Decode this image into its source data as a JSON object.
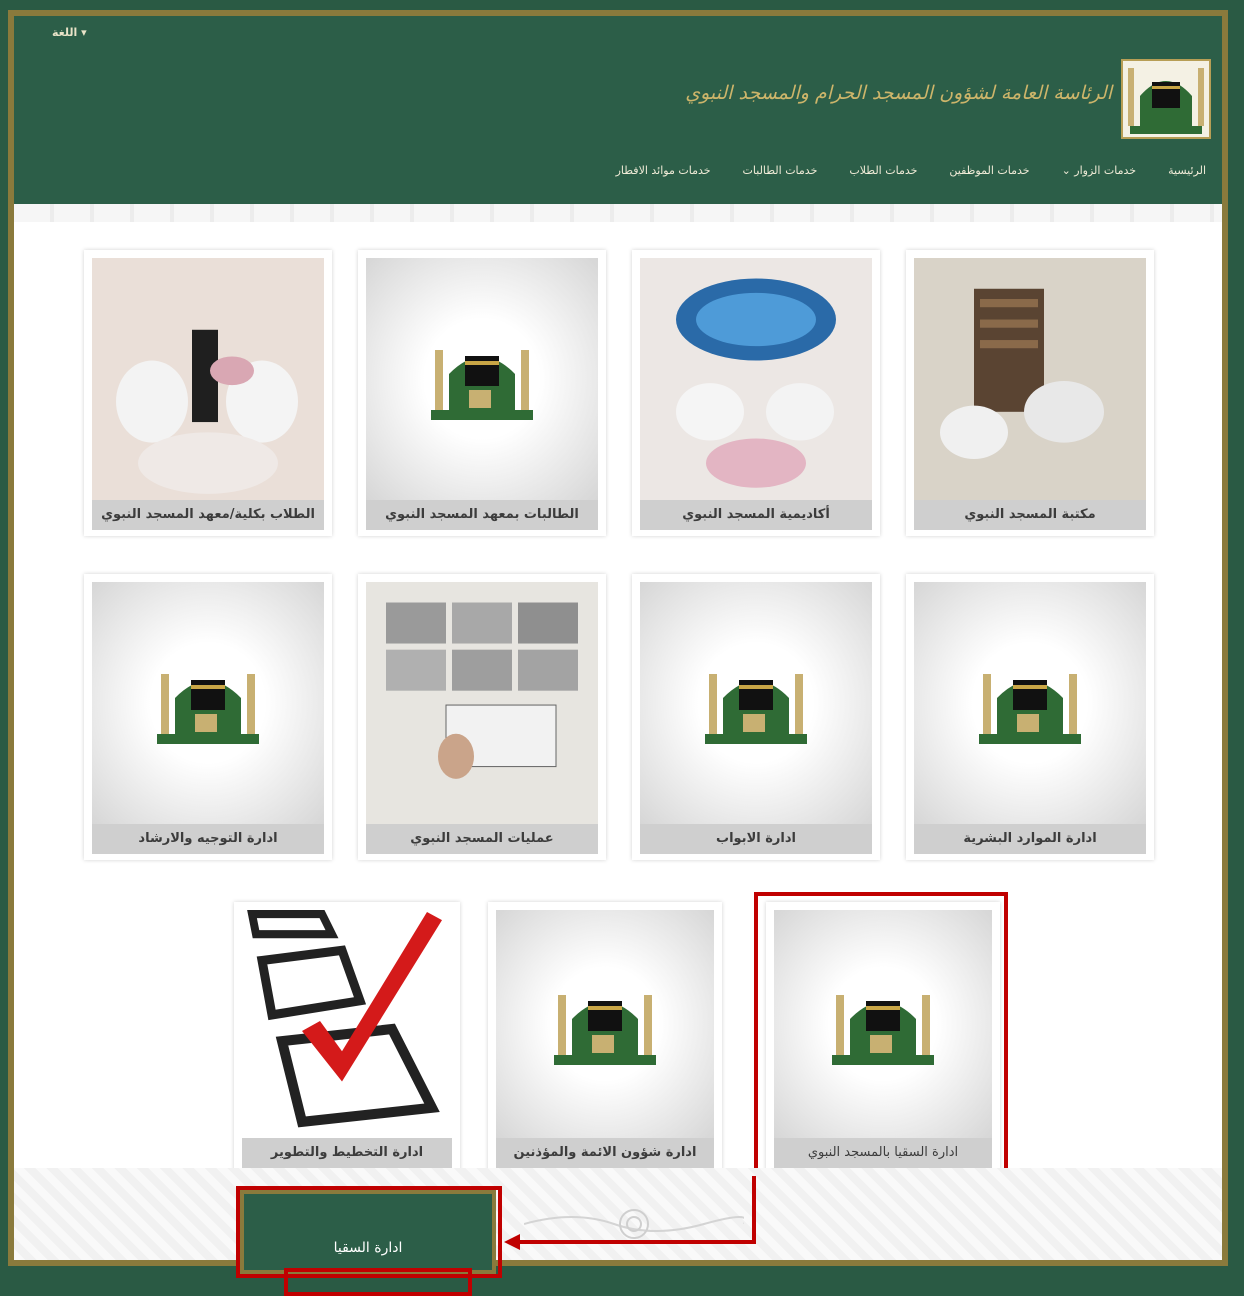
{
  "header": {
    "lang_label": "اللغة ▾",
    "logo_text": "الرئاسة العامة لشؤون المسجد الحرام والمسجد النبوي"
  },
  "nav": {
    "items": [
      "الرئيسية",
      "خدمات الزوار ⌄",
      "خدمات الموظفين",
      "خدمات الطلاب",
      "خدمات الطالبات",
      "خدمات موائد الافطار"
    ]
  },
  "cards": [
    {
      "label": "مكتبة المسجد النبوي"
    },
    {
      "label": "أكاديمية المسجد النبوي"
    },
    {
      "label": "الطالبات بمعهد المسجد النبوي"
    },
    {
      "label": "الطلاب بكلية/معهد المسجد النبوي"
    },
    {
      "label": "ادارة الموارد البشرية"
    },
    {
      "label": "ادارة الابواب"
    },
    {
      "label": "عمليات المسجد النبوي"
    },
    {
      "label": "ادارة التوجيه والارشاد"
    },
    {
      "label": "ادارة السقيا بالمسجد النبوي"
    },
    {
      "label": "ادارة شؤون الائمة والمؤذنين"
    },
    {
      "label": "ادارة التخطيط والتطوير"
    }
  ],
  "popup": {
    "label": "ادارة السقيا"
  },
  "colors": {
    "header_green": "#2c5e48",
    "gold": "#8a7a3c",
    "highlight_red": "#c00000"
  }
}
